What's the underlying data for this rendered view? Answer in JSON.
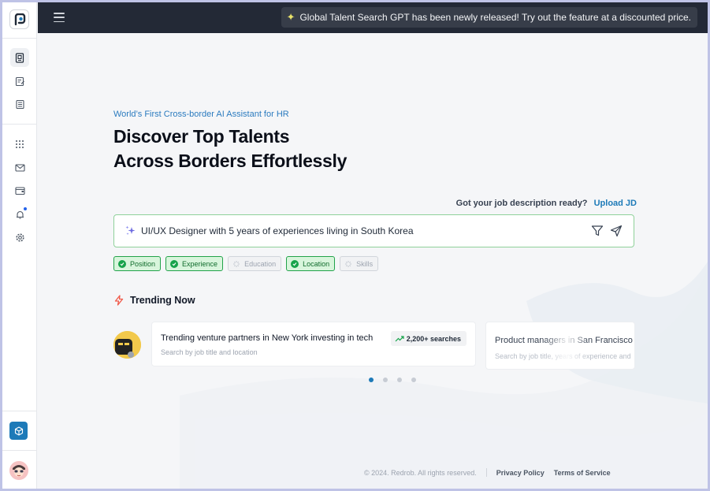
{
  "announcement": "Global Talent Search GPT has been newly released! Try out the feature at a discounted price.",
  "hero": {
    "tagline": "World’s First Cross-border AI Assistant for HR",
    "headline_line1": "Discover Top Talents",
    "headline_line2": "Across Borders Effortlessly"
  },
  "jd": {
    "question": "Got your job description ready?",
    "upload_label": "Upload JD"
  },
  "search": {
    "value": "UI/UX Designer with 5 years of experiences living in South Korea"
  },
  "chips": [
    {
      "label": "Position",
      "state": "checked"
    },
    {
      "label": "Experience",
      "state": "checked"
    },
    {
      "label": "Education",
      "state": "pending"
    },
    {
      "label": "Location",
      "state": "checked"
    },
    {
      "label": "Skills",
      "state": "pending"
    }
  ],
  "trending": {
    "label": "Trending Now",
    "cards": [
      {
        "title": "Trending venture partners in New York investing in tech",
        "subtitle": "Search by job title and location",
        "badge": "2,200+ searches"
      },
      {
        "title": "Product managers in San Francisco",
        "subtitle": "Search by job title, years of experience and"
      }
    ],
    "carousel": {
      "pages": 4,
      "active": 1
    }
  },
  "footer": {
    "copyright": "© 2024. Redrob. All rights reserved.",
    "privacy": "Privacy Policy",
    "terms": "Terms of Service"
  },
  "colors": {
    "accent": "#1d7ab8",
    "topbar": "#232936",
    "success": "#16a34a",
    "trending_icon": "#f05a4a"
  },
  "icons": {
    "sidebar": [
      "logo-icon",
      "search-page-icon",
      "notes-icon",
      "document-icon",
      "apps-grid-icon",
      "mail-icon",
      "wallet-icon",
      "bell-icon",
      "gear-icon",
      "cube-icon"
    ]
  }
}
